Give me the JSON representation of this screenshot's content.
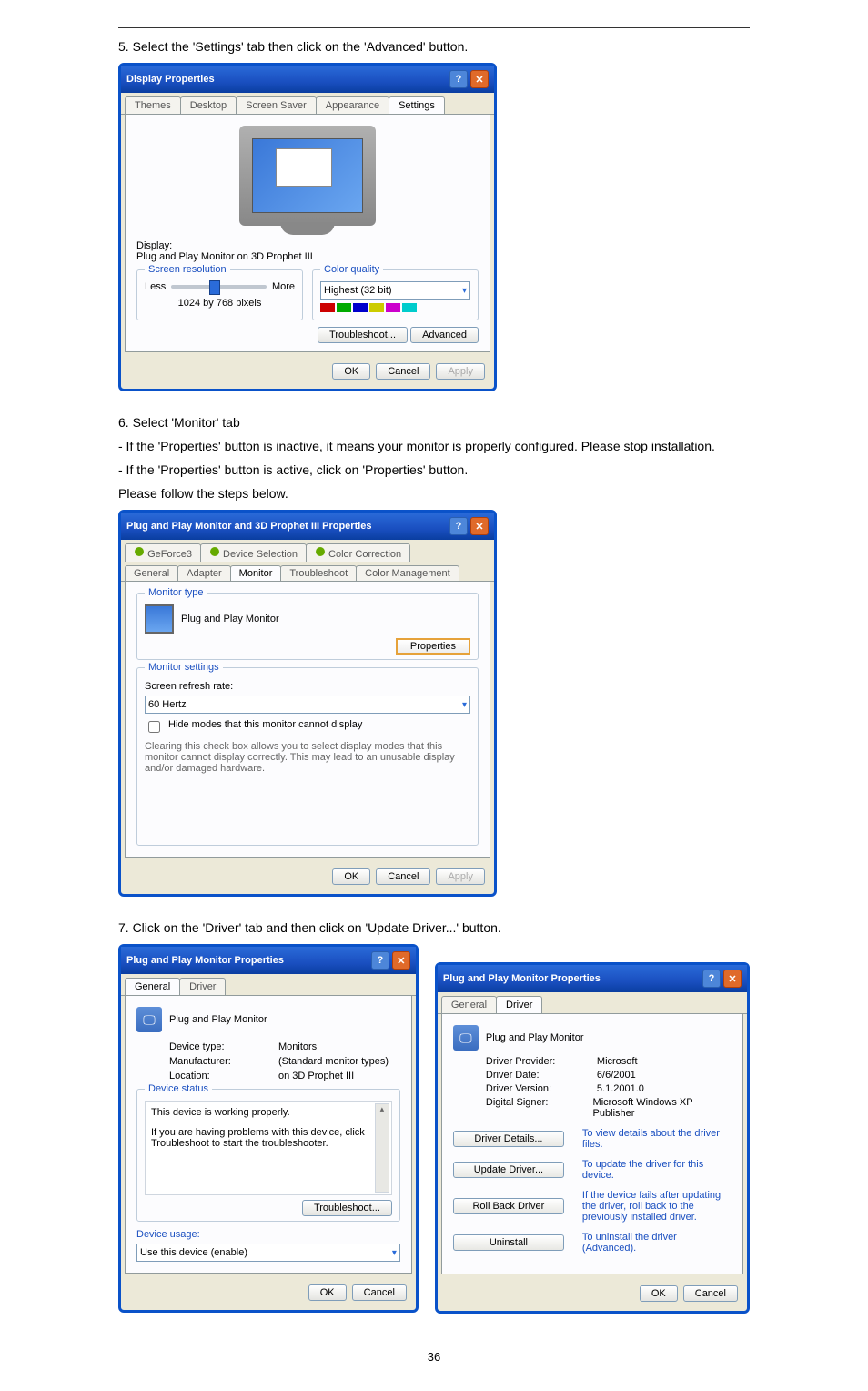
{
  "step5": "5. Select the 'Settings' tab then click on the 'Advanced' button.",
  "dlg1": {
    "title": "Display Properties",
    "tabs": [
      "Themes",
      "Desktop",
      "Screen Saver",
      "Appearance",
      "Settings"
    ],
    "display_label": "Display:",
    "display_value": "Plug and Play Monitor on 3D Prophet III",
    "screen_res_legend": "Screen resolution",
    "less": "Less",
    "more": "More",
    "res_text": "1024 by 768 pixels",
    "color_legend": "Color quality",
    "color_value": "Highest (32 bit)",
    "troubleshoot": "Troubleshoot...",
    "advanced": "Advanced",
    "ok": "OK",
    "cancel": "Cancel",
    "apply": "Apply"
  },
  "step6": "6. Select 'Monitor' tab",
  "step6_a": "- If the 'Properties' button is inactive, it means your monitor is properly configured. Please stop installation.",
  "step6_b": "- If the 'Properties' button is active, click on 'Properties' button.",
  "step6_c": "Please follow the steps below.",
  "dlg2": {
    "title": "Plug and Play Monitor and 3D Prophet III Properties",
    "row1": [
      "GeForce3",
      "Device Selection",
      "Color Correction"
    ],
    "row2": [
      "General",
      "Adapter",
      "Monitor",
      "Troubleshoot",
      "Color Management"
    ],
    "montype_legend": "Monitor type",
    "monitor_name": "Plug and Play Monitor",
    "properties": "Properties",
    "monset_legend": "Monitor settings",
    "refresh_label": "Screen refresh rate:",
    "refresh_value": "60 Hertz",
    "hide_label": "Hide modes that this monitor cannot display",
    "hide_desc": "Clearing this check box allows you to select display modes that this monitor cannot display correctly. This may lead to an unusable display and/or damaged hardware.",
    "ok": "OK",
    "cancel": "Cancel",
    "apply": "Apply"
  },
  "step7": "7. Click on the 'Driver' tab and then click on 'Update Driver...' button.",
  "dlg3": {
    "title": "Plug and Play Monitor Properties",
    "tabs": [
      "General",
      "Driver"
    ],
    "monitor_name": "Plug and Play Monitor",
    "devtype_k": "Device type:",
    "devtype_v": "Monitors",
    "manuf_k": "Manufacturer:",
    "manuf_v": "(Standard monitor types)",
    "loc_k": "Location:",
    "loc_v": "on 3D Prophet III",
    "devstatus_legend": "Device status",
    "devstatus_text": "This device is working properly.",
    "devstatus_help": "If you are having problems with this device, click Troubleshoot to start the troubleshooter.",
    "troubleshoot": "Troubleshoot...",
    "usage_legend": "Device usage:",
    "usage_value": "Use this device (enable)",
    "ok": "OK",
    "cancel": "Cancel"
  },
  "dlg4": {
    "title": "Plug and Play Monitor Properties",
    "tabs": [
      "General",
      "Driver"
    ],
    "monitor_name": "Plug and Play Monitor",
    "prov_k": "Driver Provider:",
    "prov_v": "Microsoft",
    "date_k": "Driver Date:",
    "date_v": "6/6/2001",
    "ver_k": "Driver Version:",
    "ver_v": "5.1.2001.0",
    "signer_k": "Digital Signer:",
    "signer_v": "Microsoft Windows XP Publisher",
    "details_btn": "Driver Details...",
    "details_desc": "To view details about the driver files.",
    "update_btn": "Update Driver...",
    "update_desc": "To update the driver for this device.",
    "rollback_btn": "Roll Back Driver",
    "rollback_desc": "If the device fails after updating the driver, roll back to the previously installed driver.",
    "uninstall_btn": "Uninstall",
    "uninstall_desc": "To uninstall the driver (Advanced).",
    "ok": "OK",
    "cancel": "Cancel"
  },
  "page_number": "36"
}
